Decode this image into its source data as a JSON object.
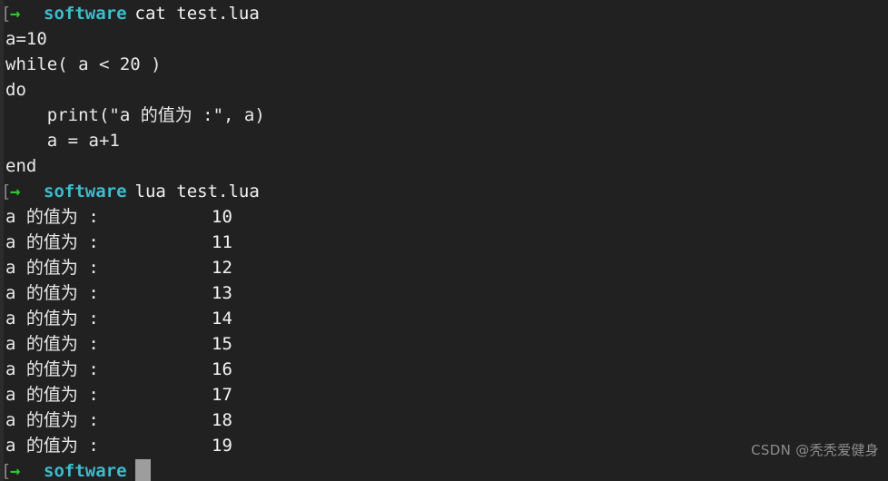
{
  "terminal": {
    "background_color": "#212121",
    "foreground_color": "#e6e6e6",
    "prompt_bracket": "[",
    "prompt_arrow": "→",
    "prompt_host": "software",
    "host_color": "#3bbccd",
    "arrow_color": "#2fc62f",
    "cursor_color": "#9d9d9d"
  },
  "lines": [
    {
      "kind": "prompt",
      "command": "cat test.lua"
    },
    {
      "kind": "code",
      "text": "a=10"
    },
    {
      "kind": "code",
      "text": "while( a < 20 )"
    },
    {
      "kind": "code",
      "text": "do"
    },
    {
      "kind": "code",
      "text": "    print(\"a 的值为 :\", a)"
    },
    {
      "kind": "code",
      "text": "    a = a+1"
    },
    {
      "kind": "code",
      "text": "end"
    },
    {
      "kind": "prompt",
      "command": "lua test.lua"
    },
    {
      "kind": "output",
      "label": "a 的值为 :",
      "value": "10"
    },
    {
      "kind": "output",
      "label": "a 的值为 :",
      "value": "11"
    },
    {
      "kind": "output",
      "label": "a 的值为 :",
      "value": "12"
    },
    {
      "kind": "output",
      "label": "a 的值为 :",
      "value": "13"
    },
    {
      "kind": "output",
      "label": "a 的值为 :",
      "value": "14"
    },
    {
      "kind": "output",
      "label": "a 的值为 :",
      "value": "15"
    },
    {
      "kind": "output",
      "label": "a 的值为 :",
      "value": "16"
    },
    {
      "kind": "output",
      "label": "a 的值为 :",
      "value": "17"
    },
    {
      "kind": "output",
      "label": "a 的值为 :",
      "value": "18"
    },
    {
      "kind": "output",
      "label": "a 的值为 :",
      "value": "19"
    },
    {
      "kind": "prompt-cursor",
      "command": ""
    }
  ],
  "watermark": {
    "text": "CSDN @秃秃爱健身",
    "color": "#8d8d8d"
  }
}
